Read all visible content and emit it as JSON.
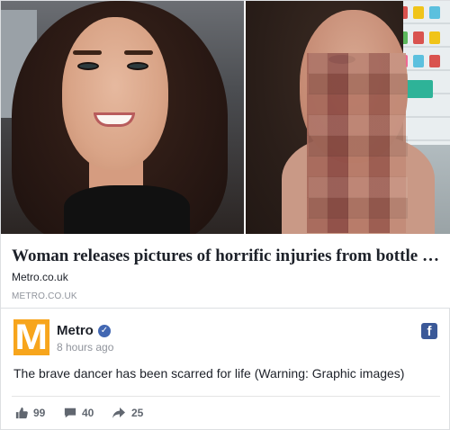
{
  "link": {
    "title": "Woman releases pictures of horrific injuries from bottle at...",
    "domain": "Metro.co.uk",
    "caption": "METRO.CO.UK"
  },
  "post": {
    "page_name": "Metro",
    "logo_letter": "M",
    "verified_mark": "✓",
    "timestamp": "8 hours ago",
    "fb_icon_letter": "f",
    "text": "The brave dancer has been scarred for life (Warning: Graphic images)"
  },
  "stats": {
    "likes": "99",
    "comments": "40",
    "shares": "25"
  },
  "colors": {
    "logo_bg": "#f7a51c",
    "verified_badge": "#4267b2",
    "facebook_blue": "#3b5998",
    "meta_text": "#90949c"
  },
  "icons": {
    "likes": "thumbs-up-icon",
    "comments": "comment-icon",
    "shares": "share-icon",
    "facebook": "facebook-icon",
    "verified": "verified-badge-icon"
  }
}
